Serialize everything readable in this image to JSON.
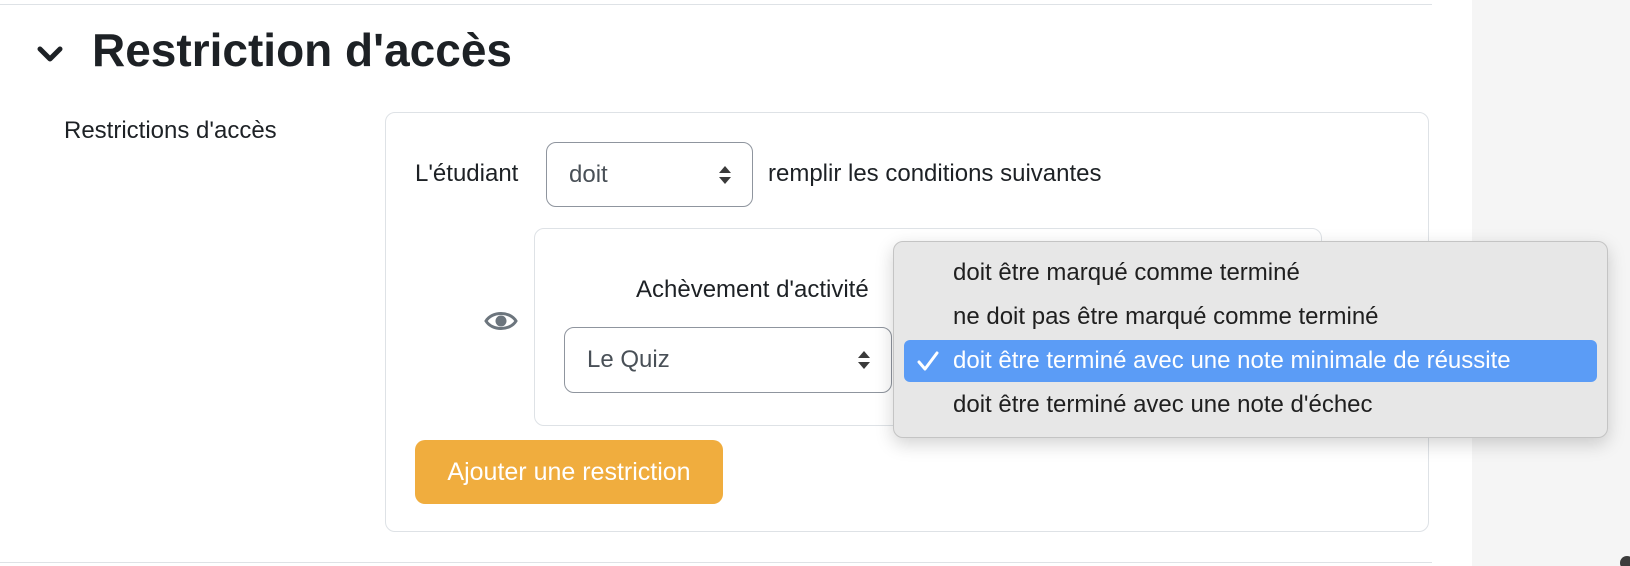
{
  "section": {
    "title": "Restriction d'accès",
    "toggle_icon": "chevron-down-icon"
  },
  "field": {
    "label": "Restrictions d'accès"
  },
  "restriction_set": {
    "prefix": "L'étudiant",
    "must_select_value": "doit",
    "suffix": "remplir les conditions suivantes"
  },
  "condition": {
    "eye_icon": "eye-icon",
    "label": "Achèvement d'activité",
    "activity_select_value": "Le Quiz"
  },
  "dropdown": {
    "options": [
      "doit être marqué comme terminé",
      "ne doit pas être marqué comme terminé",
      "doit être terminé avec une note minimale de réussite",
      "doit être terminé avec une note d'échec"
    ],
    "selected_index": 2,
    "selected_color": "#5b9cf6",
    "check_icon": "checkmark-icon"
  },
  "buttons": {
    "add_restriction": "Ajouter une restriction",
    "add_restriction_color": "#f0ad3e"
  }
}
